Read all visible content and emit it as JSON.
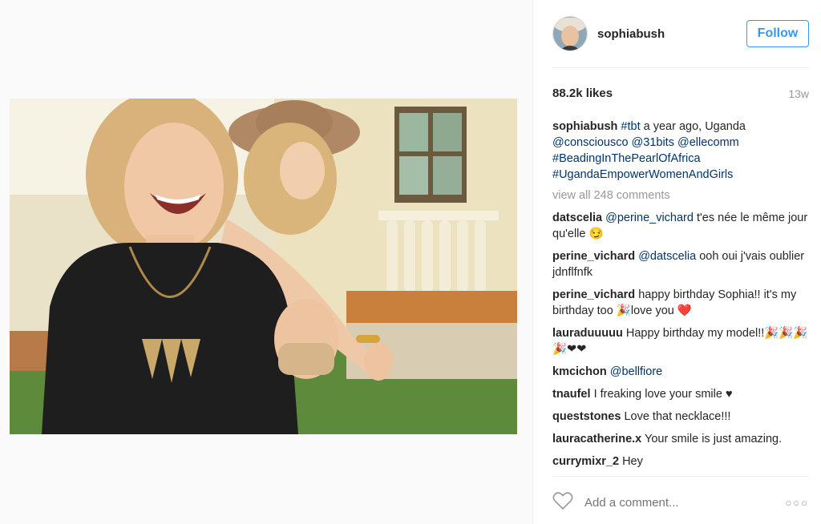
{
  "post": {
    "username": "sophiabush",
    "follow_label": "Follow",
    "likes": "88.2k likes",
    "time": "13w",
    "caption": {
      "author": "sophiabush",
      "hashtag_tbt": "#tbt",
      "text": "a year ago, Uganda",
      "mention_1": "@consciousco",
      "mention_2": "@31bits",
      "mention_3": "@ellecomm",
      "hashtag_2": "#BeadingInThePearlOfAfrica",
      "hashtag_3": "#UgandaEmpowerWomenAndGirls"
    },
    "view_all": "view all 248 comments",
    "comments": [
      {
        "user": "datscelia",
        "mention": "@perine_vichard",
        "text": "t'es née le même jour qu'elle 😏"
      },
      {
        "user": "perine_vichard",
        "mention": "@datscelia",
        "text": "ooh oui j'vais oublier jdnflfnfk"
      },
      {
        "user": "perine_vichard",
        "mention": "",
        "text": "happy birthday Sophia!! it's my birthday too 🎉love you ❤️"
      },
      {
        "user": "lauraduuuuu",
        "mention": "",
        "text": "Happy birthday my model!!🎉🎉🎉🎉❤❤"
      },
      {
        "user": "kmcichon",
        "mention": "@bellfiore",
        "text": ""
      },
      {
        "user": "tnaufel",
        "mention": "",
        "text": "I freaking love your smile ♥"
      },
      {
        "user": "queststones",
        "mention": "",
        "text": "Love that necklace!!!"
      },
      {
        "user": "lauracatherine.x",
        "mention": "",
        "text": "Your smile is just amazing."
      },
      {
        "user": "currymixr_2",
        "mention": "",
        "text": "Hey"
      }
    ],
    "add_comment_placeholder": "Add a comment...",
    "more_icon": "ellipsis-icon",
    "like_icon": "heart-outline-icon"
  }
}
